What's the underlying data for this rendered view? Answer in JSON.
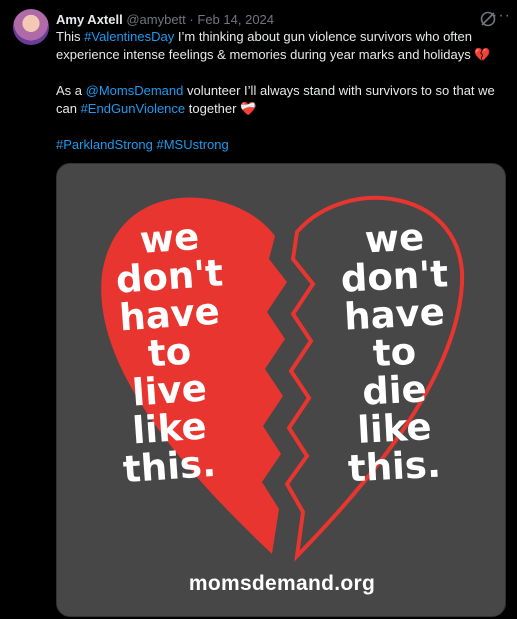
{
  "post": {
    "author_name": "Amy Axtell",
    "handle": "@amybett",
    "separator": "·",
    "date": "Feb 14, 2024",
    "more_icon": "ellipsis-icon",
    "grok_icon": "grok-icon",
    "line1_pre": "This ",
    "hashtag_valentines": "#ValentinesDay",
    "line1_post": " I’m thinking about gun violence survivors who often experience intense feelings & memories during year marks and holidays 💔",
    "line2_pre": "As a ",
    "mention_moms": "@MomsDemand",
    "line2_mid": " volunteer I’ll always stand with survivors to so that we can ",
    "hashtag_endgv": "#EndGunViolence",
    "line2_post": " together ❤️‍🩹",
    "hashtag_parkland": "#ParklandStrong",
    "hashtag_msu": "#MSUstrong"
  },
  "image": {
    "left_lines": [
      "we",
      "don't",
      "have",
      "to",
      "live",
      "like",
      "this."
    ],
    "right_lines": [
      "we",
      "don't",
      "have",
      "to",
      "die",
      "like",
      "this."
    ],
    "website": "momsdemand.org",
    "colors": {
      "background": "#474747",
      "heart_red": "#e8352f",
      "text": "#ffffff"
    }
  }
}
